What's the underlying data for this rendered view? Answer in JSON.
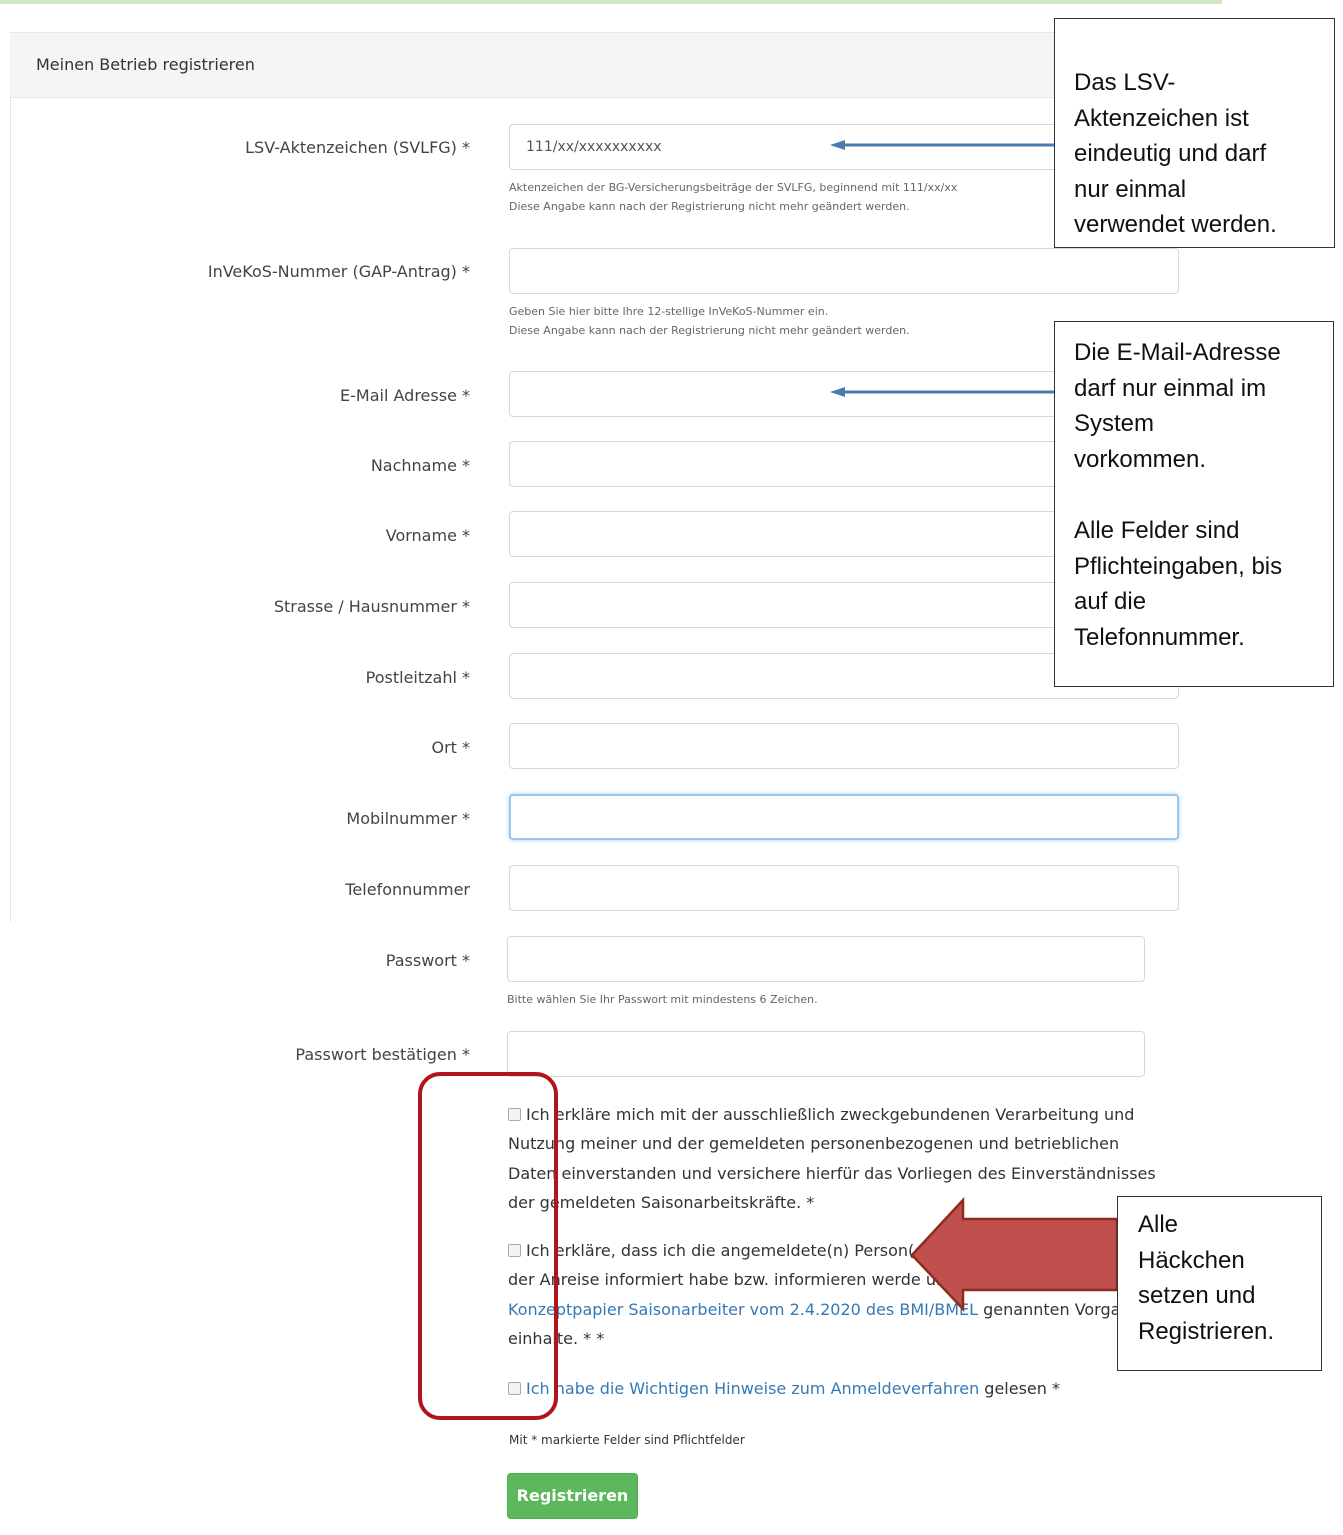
{
  "panel": {
    "title": "Meinen Betrieb registrieren"
  },
  "fields": [
    {
      "label": "LSV-Aktenzeichen (SVLFG) *",
      "value": "111/xx/xxxxxxxxxx",
      "placeholder": ""
    },
    {
      "label": "InVeKoS-Nummer (GAP-Antrag) *",
      "value": "",
      "placeholder": ""
    },
    {
      "label": "E-Mail Adresse *",
      "value": "",
      "placeholder": ""
    },
    {
      "label": "Nachname *",
      "value": "",
      "placeholder": ""
    },
    {
      "label": "Vorname *",
      "value": "",
      "placeholder": ""
    },
    {
      "label": "Strasse / Hausnummer *",
      "value": "",
      "placeholder": ""
    },
    {
      "label": "Postleitzahl *",
      "value": "",
      "placeholder": ""
    },
    {
      "label": "Ort *",
      "value": "",
      "placeholder": ""
    },
    {
      "label": "Mobilnummer *",
      "value": "",
      "placeholder": ""
    },
    {
      "label": "Telefonnummer",
      "value": "",
      "placeholder": ""
    },
    {
      "label": "Passwort *",
      "value": "",
      "placeholder": ""
    },
    {
      "label": "Passwort bestätigen *",
      "value": "",
      "placeholder": ""
    }
  ],
  "help": {
    "lsv_line1": "Aktenzeichen der BG-Versicherungsbeiträge der SVLFG, beginnend mit 111/xx/xx",
    "lsv_line2": "Diese Angabe kann nach der Registrierung nicht mehr geändert werden.",
    "invekos_line1": "Geben Sie hier bitte Ihre 12-stellige InVeKoS-Nummer ein.",
    "invekos_line2": "Diese Angabe kann nach der Registrierung nicht mehr geändert werden.",
    "password": "Bitte wählen Sie Ihr Passwort mit mindestens 6 Zeichen."
  },
  "checkboxes": {
    "consent": "Ich erkläre mich mit der ausschließlich zweckgebundenen Verarbeitung und Nutzung meiner und der gemeldeten personenbezogenen und betrieblichen Daten einverstanden und versichere hierfür das Vorliegen des Einverständnisses der gemeldeten Saisonarbeitskräfte. *",
    "infection_before": "Ich erkläre, dass ich die angemeldete(n) Person(en) zum Infektionsschutz vor der Anreise informiert habe bzw. informieren werde und auch die weiteren im ",
    "infection_link": "Konzeptpapier Saisonarbeiter vom 2.4.2020 des BMI/BMEL",
    "infection_after": " genannten Vorgaben einhalte. * *",
    "notes_link": "Ich habe die Wichtigen Hinweise zum Anmeldeverfahren",
    "notes_after": " gelesen *"
  },
  "footnote": "Mit * markierte Felder sind Pflichtfelder",
  "submit_label": "Registrieren",
  "callouts": {
    "lsv": "Das LSV-\nAktenzeichen ist\neindeutig und darf\nnur einmal\nverwendet werden.",
    "email": "Die E-Mail-Adresse\ndarf nur einmal im\nSystem\nvorkommen.\n\nAlle Felder sind\nPflichteingaben, bis\nauf die\nTelefonnummer.",
    "checks": "Alle\nHäckchen\nsetzen und\nRegistrieren."
  },
  "colors": {
    "accent_green": "#5cb85c",
    "link_blue": "#337ab7",
    "annotation_red": "#b0151b",
    "arrow_blue": "#4a7bb0"
  }
}
